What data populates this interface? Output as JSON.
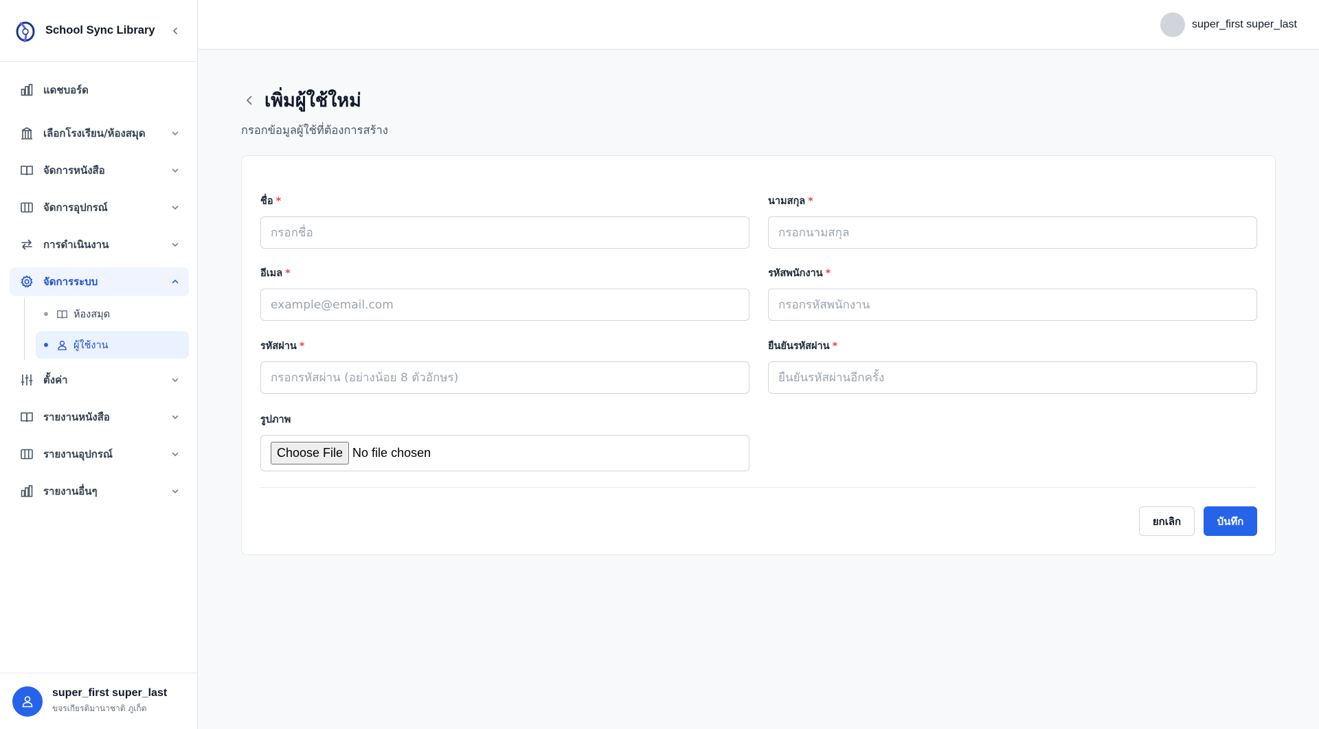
{
  "sidebar": {
    "app_name": "School Sync Library",
    "items": [
      {
        "label": "แดชบอร์ด",
        "icon": "bar-chart-icon"
      },
      {
        "label": "เลือกโรงเรียน/ห้องสมุด",
        "icon": "library-icon"
      },
      {
        "label": "จัดการหนังสือ",
        "icon": "book-open-icon"
      },
      {
        "label": "จัดการอุปกรณ์",
        "icon": "columns-icon"
      },
      {
        "label": "การดำเนินงาน",
        "icon": "arrows-swap-icon"
      },
      {
        "label": "จัดการระบบ",
        "icon": "gear-icon"
      },
      {
        "label": "ตั้งค่า",
        "icon": "sliders-icon"
      },
      {
        "label": "รายงานหนังสือ",
        "icon": "book-open-icon"
      },
      {
        "label": "รายงานอุปกรณ์",
        "icon": "columns-icon"
      },
      {
        "label": "รายงานอื่นๆ",
        "icon": "bar-chart-icon"
      }
    ],
    "sub_items": [
      {
        "label": "ห้องสมุด",
        "icon": "book-open-icon"
      },
      {
        "label": "ผู้ใช้งาน",
        "icon": "user-icon"
      }
    ],
    "footer": {
      "name": "super_first super_last",
      "school": "ขจรเกียรติมานาชาติ ภูเก็ต"
    }
  },
  "topbar": {
    "user_name": "super_first super_last"
  },
  "page": {
    "title": "เพิ่มผู้ใช้ใหม่",
    "subtitle": "กรอกข้อมูลผู้ใช้ที่ต้องการสร้าง"
  },
  "form": {
    "first_name": {
      "label": "ชื่อ",
      "placeholder": "กรอกชื่อ",
      "value": ""
    },
    "last_name": {
      "label": "นามสกุล",
      "placeholder": "กรอกนามสกุล",
      "value": ""
    },
    "email": {
      "label": "อีเมล",
      "placeholder": "example@email.com",
      "value": ""
    },
    "employee_id": {
      "label": "รหัสพนักงาน",
      "placeholder": "กรอกรหัสพนักงาน",
      "value": ""
    },
    "password": {
      "label": "รหัสผ่าน",
      "placeholder": "กรอกรหัสผ่าน (อย่างน้อย 8 ตัวอักษร)",
      "value": ""
    },
    "confirm_password": {
      "label": "ยืนยันรหัสผ่าน",
      "placeholder": "ยืนยันรหัสผ่านอีกครั้ง",
      "value": ""
    },
    "image": {
      "label": "รูปภาพ",
      "button": "Choose File",
      "status": "No file chosen"
    },
    "required_mark": "*",
    "cancel_label": "ยกเลิก",
    "save_label": "บันทึก"
  },
  "colors": {
    "accent": "#2563eb",
    "active_bg": "#eff4ff",
    "required": "#ef4444"
  }
}
